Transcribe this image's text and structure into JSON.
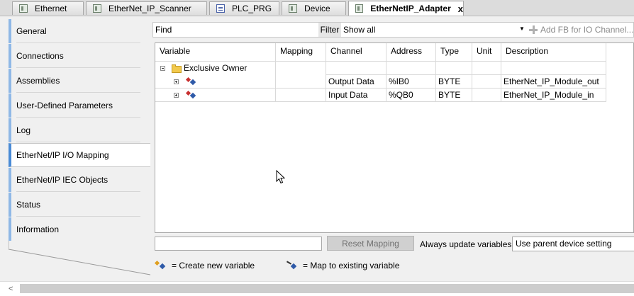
{
  "tabs": [
    {
      "label": "Ethernet",
      "icon": "device-icon"
    },
    {
      "label": "EtherNet_IP_Scanner",
      "icon": "device-icon"
    },
    {
      "label": "PLC_PRG",
      "icon": "program-icon"
    },
    {
      "label": "Device",
      "icon": "device-icon"
    },
    {
      "label": "EtherNetIP_Adapter",
      "icon": "device-icon",
      "active": true,
      "close": "x"
    }
  ],
  "nav": {
    "items": [
      {
        "label": "General"
      },
      {
        "label": "Connections"
      },
      {
        "label": "Assemblies"
      },
      {
        "label": "User-Defined Parameters"
      },
      {
        "label": "Log"
      },
      {
        "label": "EtherNet/IP I/O Mapping",
        "active": true
      },
      {
        "label": "EtherNet/IP IEC Objects"
      },
      {
        "label": "Status"
      },
      {
        "label": "Information"
      }
    ]
  },
  "toolbar": {
    "find_label": "Find",
    "filter_label": "Filter",
    "filter_value": "Show all",
    "add_fb_label": "Add FB for IO Channel..."
  },
  "grid": {
    "columns": [
      "Variable",
      "Mapping",
      "Channel",
      "Address",
      "Type",
      "Unit",
      "Description"
    ],
    "group": {
      "label": "Exclusive Owner"
    },
    "rows": [
      {
        "variable": "",
        "mapping": "",
        "channel": "Output Data",
        "address": "%IB0",
        "type": "BYTE",
        "unit": "",
        "description": "EtherNet_IP_Module_out"
      },
      {
        "variable": "",
        "mapping": "",
        "channel": "Input Data",
        "address": "%QB0",
        "type": "BYTE",
        "unit": "",
        "description": "EtherNet_IP_Module_in"
      }
    ]
  },
  "bottom": {
    "search_value": "",
    "reset_label": "Reset Mapping",
    "always_update_label": "Always update variables",
    "always_update_value": "Use parent device setting",
    "legend_create": "= Create new variable",
    "legend_map": "= Map to existing variable"
  },
  "scrollbar": {
    "left_arrow": "<"
  }
}
